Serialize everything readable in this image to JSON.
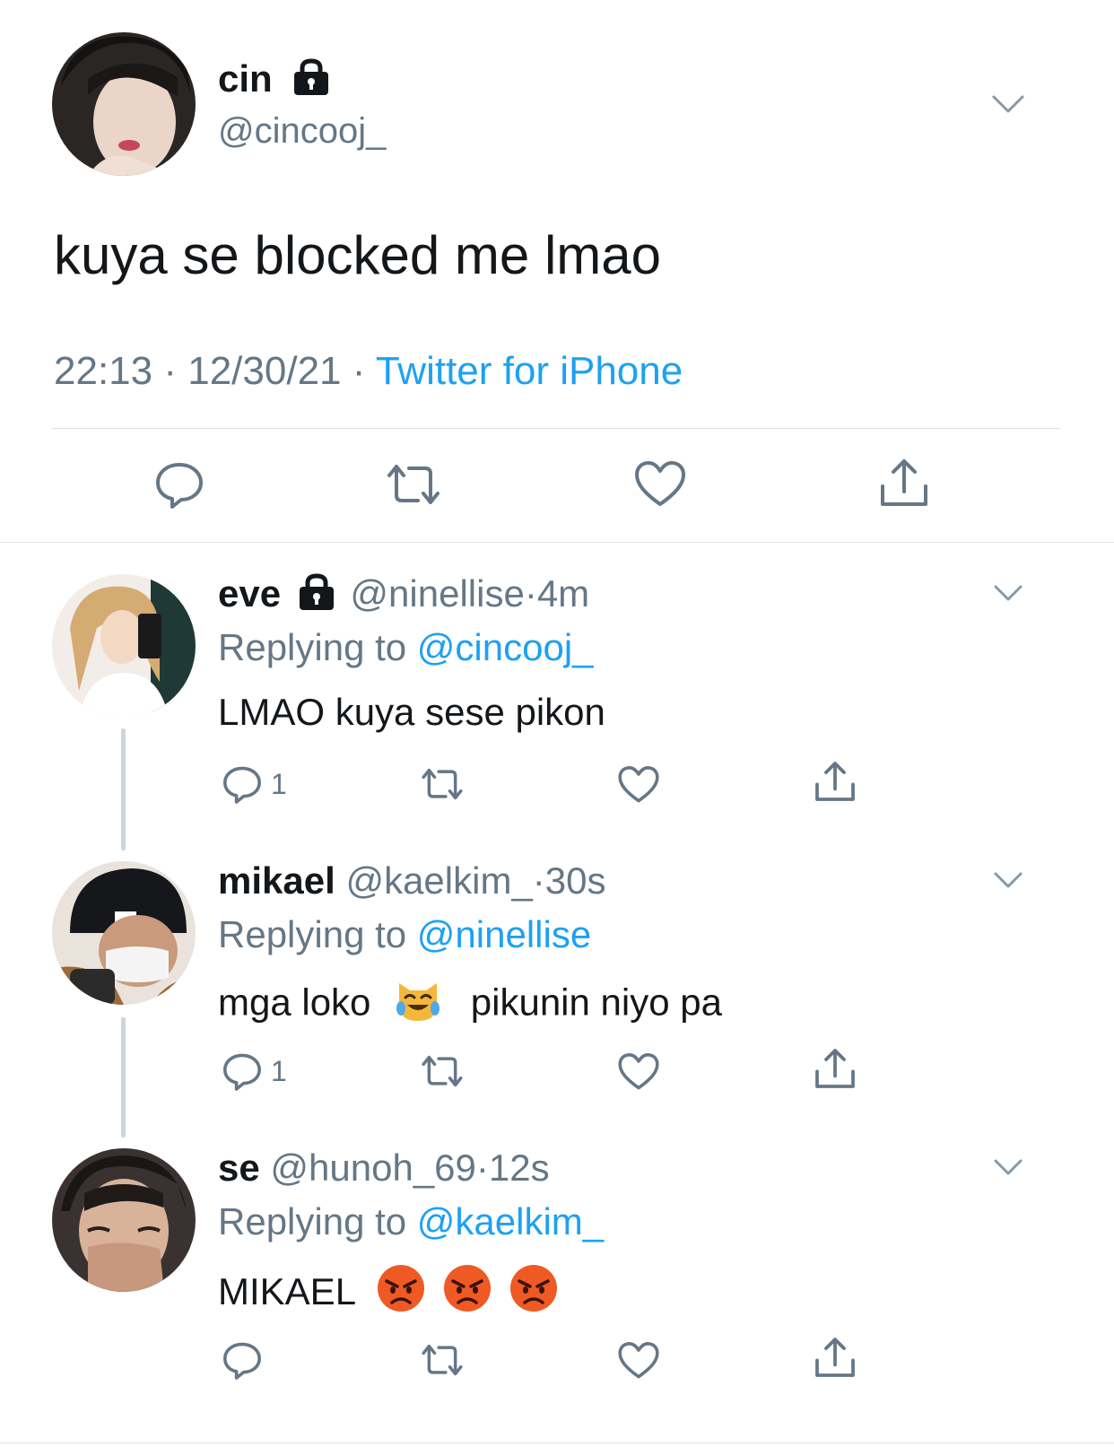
{
  "main_tweet": {
    "display_name": "cin",
    "handle": "@cincooj_",
    "text": "kuya se blocked me lmao",
    "time": "22:13",
    "date": "12/30/21",
    "sep1": "·",
    "sep2": "·",
    "source": "Twitter for iPhone"
  },
  "replies": [
    {
      "display_name": "eve",
      "handle": "@ninellise",
      "sep": "·",
      "age": "4m",
      "replying_prefix": "Replying to",
      "replying_to": "@cincooj_",
      "text": "LMAO kuya sese pikon",
      "reply_count": "1"
    },
    {
      "display_name": "mikael",
      "handle": "@kaelkim_",
      "sep": "·",
      "age": "30s",
      "replying_prefix": "Replying to",
      "replying_to": "@ninellise",
      "text_before": "mga loko",
      "text_after": "pikunin niyo pa",
      "reply_count": "1"
    },
    {
      "display_name": "se",
      "handle": "@hunoh_69",
      "sep": "·",
      "age": "12s",
      "replying_prefix": "Replying to",
      "replying_to": "@kaelkim_",
      "text": "MIKAEL",
      "reply_count": ""
    }
  ],
  "icons": [
    "lock-icon",
    "chevron-down-icon",
    "reply-icon",
    "retweet-icon",
    "like-icon",
    "share-icon",
    "cat-tears-of-joy-emoji",
    "angry-face-emoji"
  ],
  "colors": {
    "accent": "#1da1f2",
    "secondary_text": "#657786",
    "primary_text": "#14171a",
    "divider": "#dfe3e6"
  }
}
